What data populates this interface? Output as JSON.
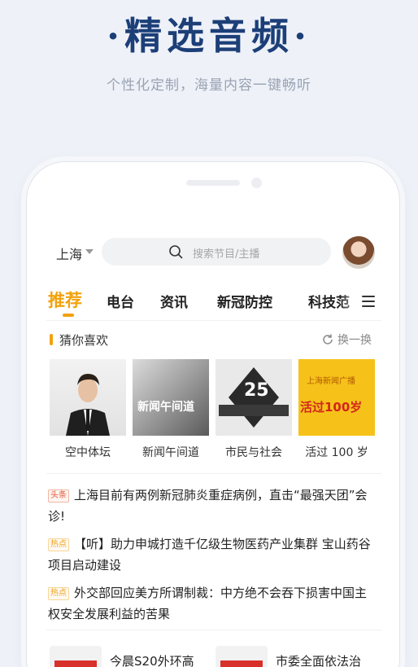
{
  "banner": {
    "title": "·精选音频·",
    "subtitle": "个性化定制，海量内容一键畅听"
  },
  "topbar": {
    "city": "上海",
    "search_placeholder": "搜索节目/主播"
  },
  "tabs": [
    {
      "label": "推荐",
      "active": true
    },
    {
      "label": "电台",
      "active": false
    },
    {
      "label": "资讯",
      "active": false
    },
    {
      "label": "新冠防控",
      "active": false
    },
    {
      "label": "科技范",
      "active": false
    }
  ],
  "section": {
    "title": "猜你喜欢",
    "refresh_label": "换一换"
  },
  "cards": [
    {
      "label": "空中体坛",
      "thumb_text": ""
    },
    {
      "label": "新闻午间道",
      "thumb_text": "新闻午间道"
    },
    {
      "label": "市民与社会",
      "thumb_text": "25"
    },
    {
      "label": "活过 100 岁",
      "thumb_text": "活过100岁",
      "thumb_header": "上海新闻广播"
    }
  ],
  "news": [
    {
      "tag": "头条",
      "tag_style": "red",
      "text": "上海目前有两例新冠肺炎重症病例，直击“最强天团”会诊!"
    },
    {
      "tag": "热点",
      "tag_style": "orange",
      "text": "【听】助力申城打造千亿级生物医药产业集群 宝山药谷项目启动建设"
    },
    {
      "tag": "热点",
      "tag_style": "orange",
      "text": "外交部回应美方所谓制裁：中方绝不会吞下损害中国主权安全发展利益的苦果"
    }
  ],
  "bottom_items": [
    {
      "title": "今晨S20外环高"
    },
    {
      "title": "市委全面依法治"
    }
  ],
  "colors": {
    "accent": "#f2a20c",
    "banner_title": "#1c3f78",
    "hot_tag": "#f0a020",
    "headline_tag": "#e25a3a"
  }
}
